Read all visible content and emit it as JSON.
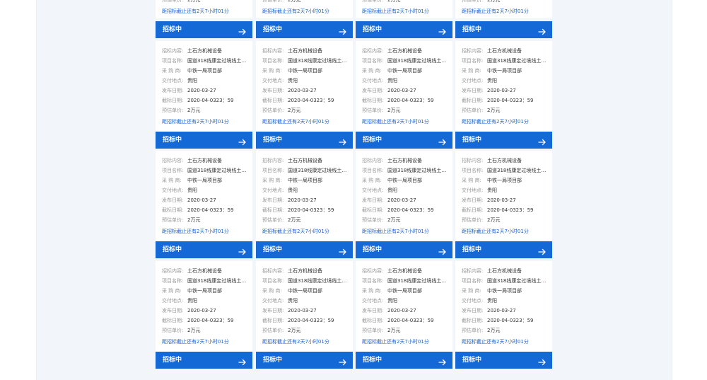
{
  "labels": {
    "content": "招标内容:",
    "project": "项目名称:",
    "buyer": "采 购 商:",
    "location": "交付地点:",
    "publish": "发布日期:",
    "deadline": "截标日期:",
    "price": "预估单价:"
  },
  "button_label": "招标中",
  "top_partial_cards": [
    {
      "price": "2万元",
      "deadline_note": "距招标截止还有2天7小时01分"
    },
    {
      "price": "2万元",
      "deadline_note": "距招标截止还有2天7小时01分"
    },
    {
      "price": "2万元",
      "deadline_note": "距招标截止还有2天7小时01分"
    },
    {
      "price": "2万元",
      "deadline_note": "距招标截止还有2天7小时01分"
    }
  ],
  "tenders": [
    {
      "content": "土石方机械设备",
      "project": "国道318线康定过境线土方...",
      "buyer": "中铁一局项目部",
      "location": "贵阳",
      "publish": "2020-03-27",
      "deadline": "2020-04-0323：59",
      "price": "2万元",
      "deadline_note": "距招标截止还有2天7小时01分"
    },
    {
      "content": "土石方机械设备",
      "project": "国道318线康定过境线土方...",
      "buyer": "中铁一局项目部",
      "location": "贵阳",
      "publish": "2020-03-27",
      "deadline": "2020-04-0323：59",
      "price": "2万元",
      "deadline_note": "距招标截止还有2天7小时01分"
    },
    {
      "content": "土石方机械设备",
      "project": "国道318线康定过境线土方...",
      "buyer": "中铁一局项目部",
      "location": "贵阳",
      "publish": "2020-03-27",
      "deadline": "2020-04-0323：59",
      "price": "2万元",
      "deadline_note": "距招标截止还有2天7小时01分"
    },
    {
      "content": "土石方机械设备",
      "project": "国道318线康定过境线土方...",
      "buyer": "中铁一局项目部",
      "location": "贵阳",
      "publish": "2020-03-27",
      "deadline": "2020-04-0323：59",
      "price": "2万元",
      "deadline_note": "距招标截止还有2天7小时01分"
    },
    {
      "content": "土石方机械设备",
      "project": "国道318线康定过境线土方...",
      "buyer": "中铁一局项目部",
      "location": "贵阳",
      "publish": "2020-03-27",
      "deadline": "2020-04-0323：59",
      "price": "2万元",
      "deadline_note": "距招标截止还有2天7小时01分"
    },
    {
      "content": "土石方机械设备",
      "project": "国道318线康定过境线土方...",
      "buyer": "中铁一局项目部",
      "location": "贵阳",
      "publish": "2020-03-27",
      "deadline": "2020-04-0323：59",
      "price": "2万元",
      "deadline_note": "距招标截止还有2天7小时01分"
    },
    {
      "content": "土石方机械设备",
      "project": "国道318线康定过境线土方...",
      "buyer": "中铁一局项目部",
      "location": "贵阳",
      "publish": "2020-03-27",
      "deadline": "2020-04-0323：59",
      "price": "2万元",
      "deadline_note": "距招标截止还有2天7小时01分"
    },
    {
      "content": "土石方机械设备",
      "project": "国道318线康定过境线土方...",
      "buyer": "中铁一局项目部",
      "location": "贵阳",
      "publish": "2020-03-27",
      "deadline": "2020-04-0323：59",
      "price": "2万元",
      "deadline_note": "距招标截止还有2天7小时01分"
    },
    {
      "content": "土石方机械设备",
      "project": "国道318线康定过境线土方...",
      "buyer": "中铁一局项目部",
      "location": "贵阳",
      "publish": "2020-03-27",
      "deadline": "2020-04-0323：59",
      "price": "2万元",
      "deadline_note": "距招标截止还有2天7小时01分"
    },
    {
      "content": "土石方机械设备",
      "project": "国道318线康定过境线土方...",
      "buyer": "中铁一局项目部",
      "location": "贵阳",
      "publish": "2020-03-27",
      "deadline": "2020-04-0323：59",
      "price": "2万元",
      "deadline_note": "距招标截止还有2天7小时01分"
    },
    {
      "content": "土石方机械设备",
      "project": "国道318线康定过境线土方...",
      "buyer": "中铁一局项目部",
      "location": "贵阳",
      "publish": "2020-03-27",
      "deadline": "2020-04-0323：59",
      "price": "2万元",
      "deadline_note": "距招标截止还有2天7小时01分"
    },
    {
      "content": "土石方机械设备",
      "project": "国道318线康定过境线土方...",
      "buyer": "中铁一局项目部",
      "location": "贵阳",
      "publish": "2020-03-27",
      "deadline": "2020-04-0323：59",
      "price": "2万元",
      "deadline_note": "距招标截止还有2天7小时01分"
    }
  ],
  "colors": {
    "accent": "#1469d6",
    "link": "#1a5fcf",
    "panel_bg": "#f2f6fb"
  },
  "icons": {
    "button_arrow": "arrow-right-icon"
  }
}
